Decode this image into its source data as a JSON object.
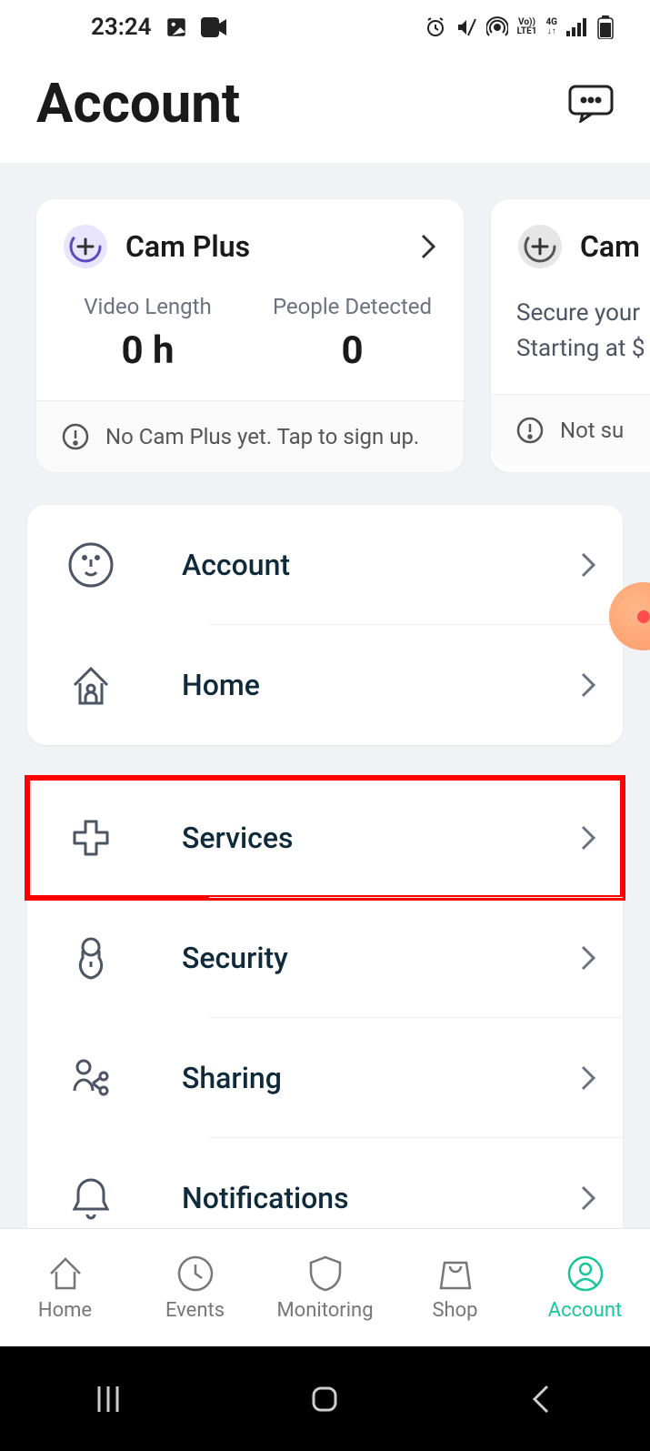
{
  "status": {
    "time": "23:24",
    "network_small": "Vo))",
    "network_lte": "LTE1",
    "network_4g": "4G"
  },
  "header": {
    "title": "Account"
  },
  "cards": [
    {
      "title": "Cam Plus",
      "stats": [
        {
          "label": "Video Length",
          "value": "0 h"
        },
        {
          "label": "People Detected",
          "value": "0"
        }
      ],
      "footer": "No Cam Plus yet. Tap to sign up."
    },
    {
      "title": "Cam",
      "body": "Secure your\nStarting at $",
      "footer": "Not su"
    }
  ],
  "menu1": [
    {
      "label": "Account"
    },
    {
      "label": "Home"
    }
  ],
  "menu2": [
    {
      "label": "Services"
    },
    {
      "label": "Security"
    },
    {
      "label": "Sharing"
    },
    {
      "label": "Notifications"
    }
  ],
  "nav": [
    {
      "label": "Home"
    },
    {
      "label": "Events"
    },
    {
      "label": "Monitoring"
    },
    {
      "label": "Shop"
    },
    {
      "label": "Account"
    }
  ]
}
